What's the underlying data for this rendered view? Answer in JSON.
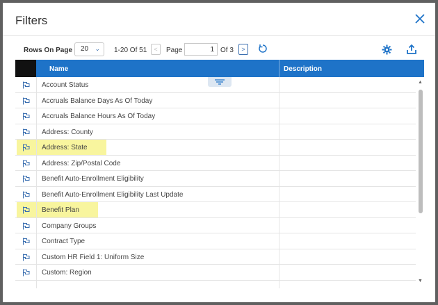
{
  "dialog": {
    "title": "Filters"
  },
  "toolbar": {
    "rows_label": "Rows On Page",
    "rows_value": "20",
    "range": "1-20 Of 51",
    "page_label": "Page",
    "page_value": "1",
    "of_label": "Of 3"
  },
  "grid": {
    "columns": [
      "Name",
      "Description"
    ],
    "rows": [
      {
        "name": "Account Status",
        "highlighted": false
      },
      {
        "name": "Accruals Balance Days As Of Today",
        "highlighted": false
      },
      {
        "name": "Accruals Balance Hours As Of Today",
        "highlighted": false
      },
      {
        "name": "Address: County",
        "highlighted": false
      },
      {
        "name": "Address: State",
        "highlighted": true
      },
      {
        "name": "Address: Zip/Postal Code",
        "highlighted": false
      },
      {
        "name": "Benefit Auto-Enrollment Eligibility",
        "highlighted": false
      },
      {
        "name": "Benefit Auto-Enrollment Eligibility Last Update",
        "highlighted": false
      },
      {
        "name": "Benefit Plan",
        "highlighted": true
      },
      {
        "name": "Company Groups",
        "highlighted": false
      },
      {
        "name": "Contract Type",
        "highlighted": false
      },
      {
        "name": "Custom HR Field 1: Uniform Size",
        "highlighted": false
      },
      {
        "name": "Custom: Region",
        "highlighted": false
      },
      {
        "name": "",
        "highlighted": false
      }
    ]
  },
  "colors": {
    "accent": "#1e73c8",
    "highlight": "#f8f59e",
    "flag": "#3b6fb0"
  },
  "icons": [
    "close-icon",
    "chevron-down-icon",
    "chevron-left-icon",
    "chevron-right-icon",
    "refresh-icon",
    "gear-icon",
    "export-icon",
    "filter-icon",
    "flag-icon"
  ]
}
